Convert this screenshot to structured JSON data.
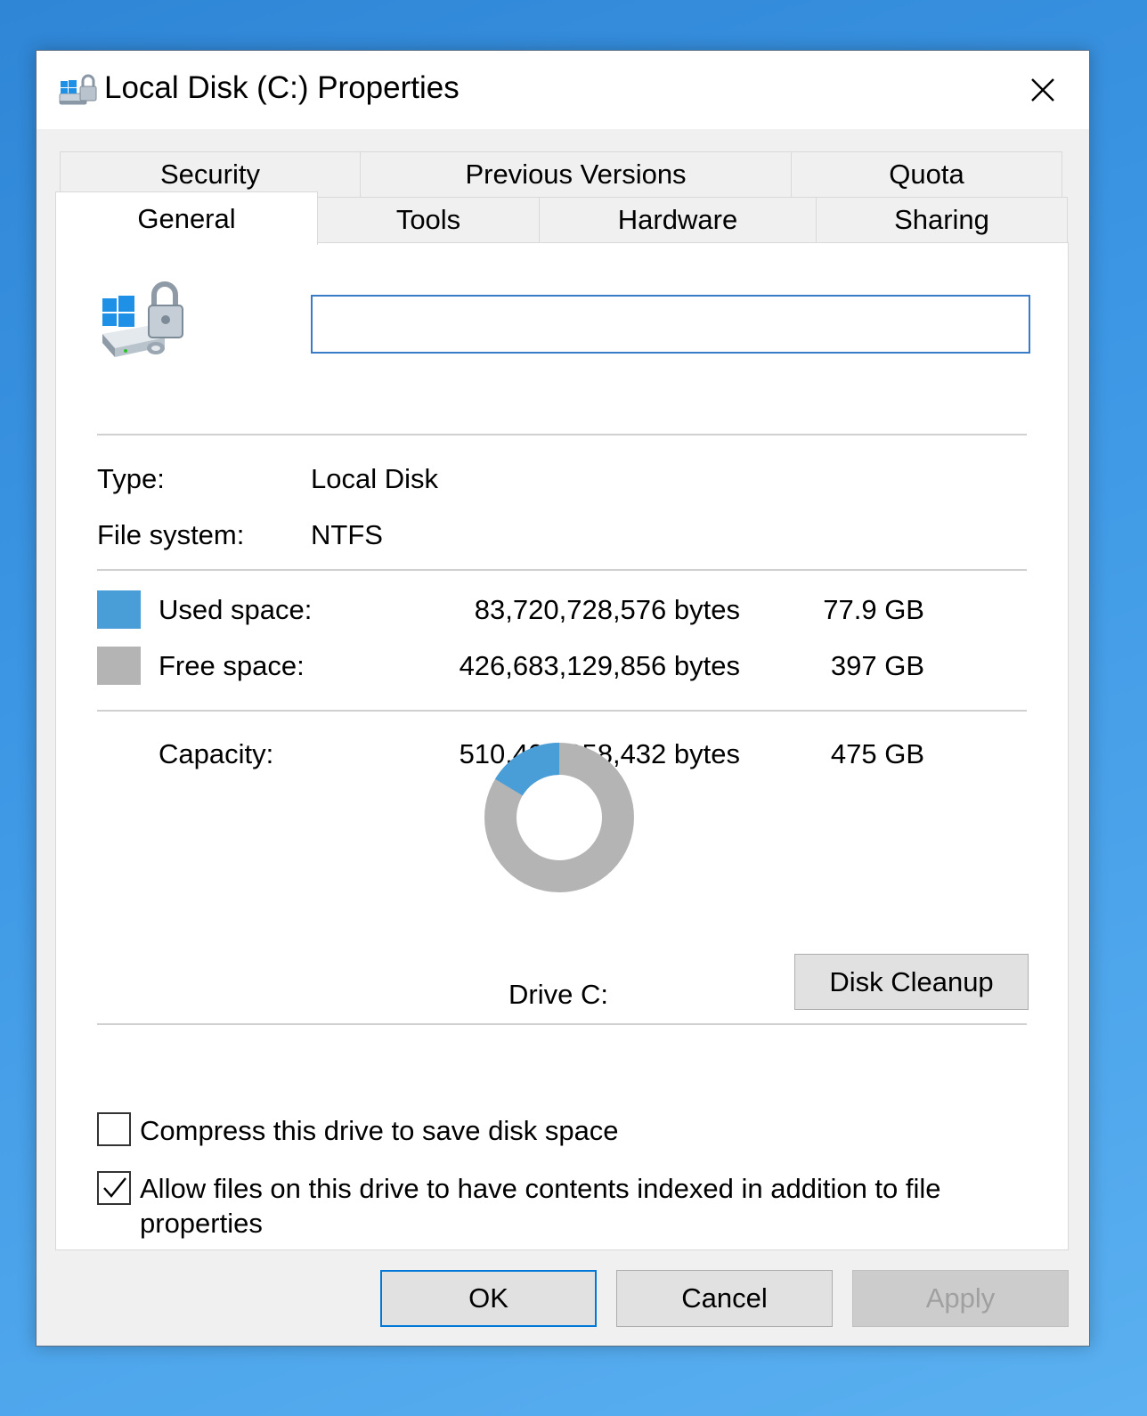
{
  "window": {
    "title": "Local Disk (C:) Properties"
  },
  "tabs": {
    "row1": [
      "Security",
      "Previous Versions",
      "Quota"
    ],
    "row2": [
      "General",
      "Tools",
      "Hardware",
      "Sharing"
    ],
    "active": "General"
  },
  "general": {
    "volume_label_value": "",
    "type_label": "Type:",
    "type_value": "Local Disk",
    "fs_label": "File system:",
    "fs_value": "NTFS",
    "used": {
      "label": "Used space:",
      "bytes": "83,720,728,576 bytes",
      "size": "77.9 GB",
      "color": "#4a9ed8"
    },
    "free": {
      "label": "Free space:",
      "bytes": "426,683,129,856 bytes",
      "size": "397 GB",
      "color": "#b4b4b4"
    },
    "capacity": {
      "label": "Capacity:",
      "bytes": "510,403,858,432 bytes",
      "size": "475 GB"
    },
    "used_fraction": 0.164,
    "drive_label": "Drive C:",
    "disk_cleanup_label": "Disk Cleanup",
    "compress_label": "Compress this drive to save disk space",
    "compress_checked": false,
    "index_label": "Allow files on this drive to have contents indexed in addition to file properties",
    "index_checked": true
  },
  "buttons": {
    "ok": "OK",
    "cancel": "Cancel",
    "apply": "Apply"
  },
  "icons": {
    "title": "drive-lock-icon",
    "close": "close-icon",
    "drive": "drive-lock-icon"
  }
}
